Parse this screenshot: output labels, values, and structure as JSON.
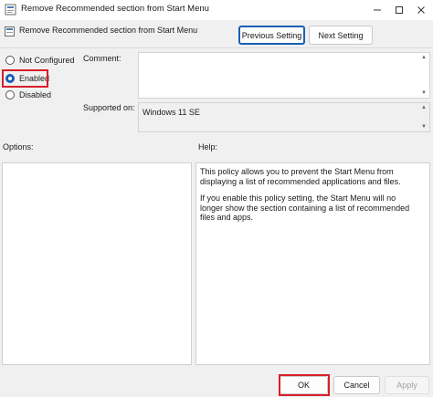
{
  "window": {
    "title": "Remove Recommended section from Start Menu"
  },
  "header": {
    "policy_title": "Remove Recommended section from Start Menu",
    "prev_label": "Previous Setting",
    "next_label": "Next Setting"
  },
  "state": {
    "options": [
      {
        "label": "Not Configured",
        "checked": false
      },
      {
        "label": "Enabled",
        "checked": true
      },
      {
        "label": "Disabled",
        "checked": false
      }
    ]
  },
  "comment": {
    "label": "Comment:",
    "value": ""
  },
  "supported": {
    "label": "Supported on:",
    "value": "Windows 11 SE"
  },
  "options_panel": {
    "label": "Options:"
  },
  "help_panel": {
    "label": "Help:",
    "paragraphs": [
      "This policy allows you to prevent the Start Menu from displaying a list of recommended applications and files.",
      "If you enable this policy setting, the Start Menu will no longer show the section containing a list of recommended files and apps."
    ]
  },
  "footer": {
    "ok_label": "OK",
    "cancel_label": "Cancel",
    "apply_label": "Apply"
  },
  "colors": {
    "highlight": "#d81e2a",
    "accent": "#1a5fb4"
  },
  "icons": {
    "app": "policy-app-icon",
    "minimize": "minimize-icon",
    "maximize": "maximize-icon",
    "close": "close-icon"
  }
}
